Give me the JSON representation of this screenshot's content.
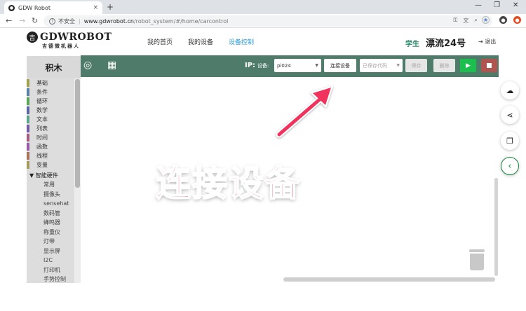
{
  "browser": {
    "tab_title": "GDW Robot",
    "tab_close": "×",
    "new_tab": "+",
    "win_min": "—",
    "win_max": "❐",
    "win_close": "✕",
    "security": "不安全",
    "url_host": "www.gdwrobot.cn",
    "url_path": "/robot_system/#/home/carcontrol"
  },
  "site": {
    "logo_mark": "吉",
    "logo_text": "GDWROBOT",
    "logo_sub": "吉德微机器人",
    "nav": [
      "我的首页",
      "我的设备",
      "设备控制"
    ],
    "nav_active_index": 2,
    "role": "学生",
    "username": "漂流24号",
    "logout": "退出"
  },
  "toolbar": {
    "ip_label": "IP:",
    "device_label": "设备:",
    "device_value": "pi024",
    "connect_button": "连接设备",
    "saved_code_placeholder": "已保存代码",
    "save_button": "保存",
    "delete_button": "删除"
  },
  "sidebar": {
    "header": "积木",
    "categories": [
      {
        "label": "基础",
        "color": "#a0a050"
      },
      {
        "label": "条件",
        "color": "#5b80a5"
      },
      {
        "label": "循环",
        "color": "#5ba55b"
      },
      {
        "label": "数学",
        "color": "#5b67a5"
      },
      {
        "label": "文本",
        "color": "#5ba58c"
      },
      {
        "label": "列表",
        "color": "#745ba5"
      },
      {
        "label": "时间",
        "color": "#a55b80"
      },
      {
        "label": "函数",
        "color": "#995ba5"
      },
      {
        "label": "线程",
        "color": "#a5745b"
      },
      {
        "label": "变量",
        "color": "#a59a5b"
      }
    ],
    "hardware_title": "▼ 智能硬件",
    "hardware_items": [
      "常用",
      "摄像头",
      "sensehat",
      "数码管",
      "蜂鸣器",
      "称重仪",
      "灯带",
      "显示屏",
      "I2C",
      "打印机",
      "手势控制"
    ]
  },
  "annotation": {
    "text": "连接设备",
    "color": "#f0305b"
  }
}
